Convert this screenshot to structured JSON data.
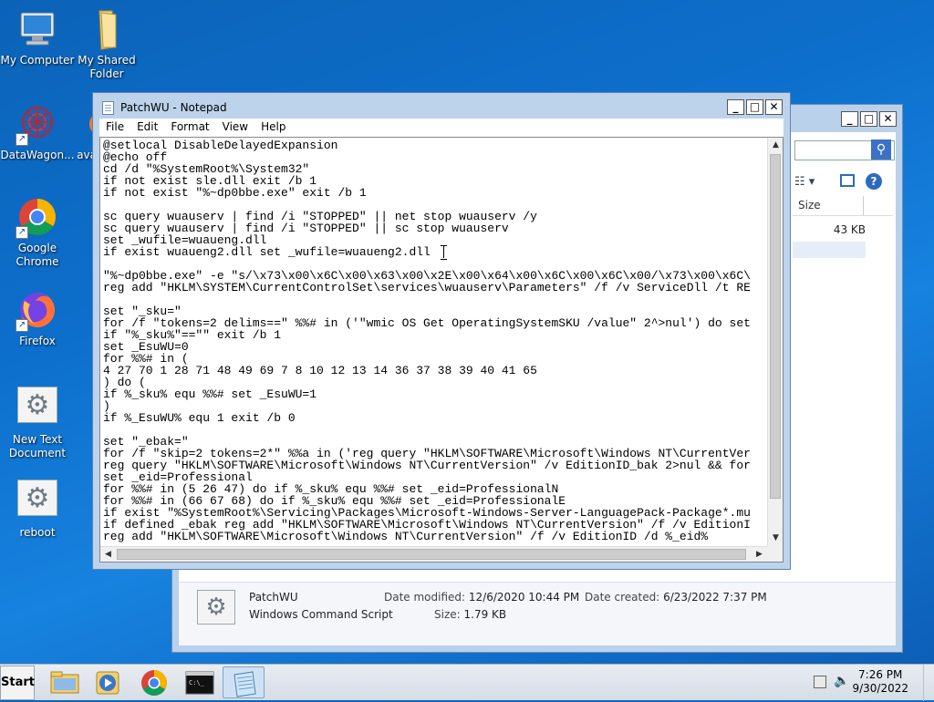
{
  "desktop": {
    "icons": [
      {
        "label": "My Computer"
      },
      {
        "label": "My Shared Folder"
      },
      {
        "label": "DataWagon..."
      },
      {
        "label": "ava"
      },
      {
        "label": "Google Chrome"
      },
      {
        "label": "Firefox"
      },
      {
        "label": "New Text Document"
      },
      {
        "label": "reboot"
      }
    ]
  },
  "notepad": {
    "title": "PatchWU - Notepad",
    "menu": [
      "File",
      "Edit",
      "Format",
      "View",
      "Help"
    ],
    "lines": [
      "@setlocal DisableDelayedExpansion",
      "@echo off",
      "cd /d \"%SystemRoot%\\System32\"",
      "if not exist sle.dll exit /b 1",
      "if not exist \"%~dp0bbe.exe\" exit /b 1",
      "",
      "sc query wuauserv | find /i \"STOPPED\" || net stop wuauserv /y",
      "sc query wuauserv | find /i \"STOPPED\" || sc stop wuauserv",
      "set _wufile=wuaueng.dll",
      "if exist wuaueng2.dll set _wufile=wuaueng2.dll",
      "",
      "\"%~dp0bbe.exe\" -e \"s/\\x73\\x00\\x6C\\x00\\x63\\x00\\x2E\\x00\\x64\\x00\\x6C\\x00\\x6C\\x00/\\x73\\x00\\x6C\\",
      "reg add \"HKLM\\SYSTEM\\CurrentControlSet\\services\\wuauserv\\Parameters\" /f /v ServiceDll /t RE",
      "",
      "set \"_sku=\"",
      "for /f \"tokens=2 delims==\" %%# in ('\"wmic OS Get OperatingSystemSKU /value\" 2^>nul') do set",
      "if \"%_sku%\"==\"\" exit /b 1",
      "set _EsuWU=0",
      "for %%# in (",
      "4 27 70 1 28 71 48 49 69 7 8 10 12 13 14 36 37 38 39 40 41 65",
      ") do (",
      "if %_sku% equ %%# set _EsuWU=1",
      ")",
      "if %_EsuWU% equ 1 exit /b 0",
      "",
      "set \"_ebak=\"",
      "for /f \"skip=2 tokens=2*\" %%a in ('reg query \"HKLM\\SOFTWARE\\Microsoft\\Windows NT\\CurrentVer",
      "reg query \"HKLM\\SOFTWARE\\Microsoft\\Windows NT\\CurrentVersion\" /v EditionID_bak 2>nul && for",
      "set _eid=Professional",
      "for %%# in (5 26 47) do if %_sku% equ %%# set _eid=ProfessionalN",
      "for %%# in (66 67 68) do if %_sku% equ %%# set _eid=ProfessionalE",
      "if exist \"%SystemRoot%\\Servicing\\Packages\\Microsoft-Windows-Server-LanguagePack-Package*.mu",
      "if defined _ebak reg add \"HKLM\\SOFTWARE\\Microsoft\\Windows NT\\CurrentVersion\" /f /v EditionI",
      "reg add \"HKLM\\SOFTWARE\\Microsoft\\Windows NT\\CurrentVersion\" /f /v EditionID /d %_eid%"
    ]
  },
  "explorer": {
    "column_header": "Size",
    "row_size": "43 KB",
    "details": {
      "name": "PatchWU",
      "type": "Windows Command Script",
      "date_modified_label": "Date modified:",
      "date_modified": "12/6/2020 10:44 PM",
      "date_created_label": "Date created:",
      "date_created": "6/23/2022 7:37 PM",
      "size_label": "Size:",
      "size": "1.79 KB"
    }
  },
  "taskbar": {
    "start_label": "Start",
    "time": "7:26 PM",
    "date": "9/30/2022"
  }
}
